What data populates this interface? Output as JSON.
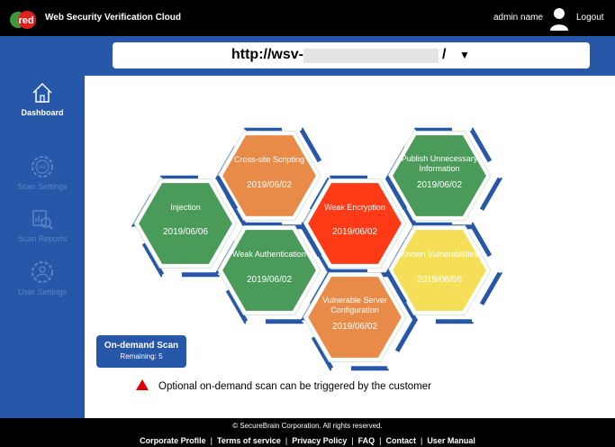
{
  "header": {
    "logo_text": "red",
    "app_title": "Web Security Verification Cloud",
    "admin_name": "admin name",
    "logout_label": "Logout"
  },
  "url_bar": {
    "url_prefix": "http://wsv-",
    "url_suffix": "/",
    "dropdown_glyph": "▼"
  },
  "sidebar": {
    "items": [
      {
        "label": "Dashboard",
        "icon": "home-icon"
      },
      {
        "label": "Scan Settings",
        "icon": "url-settings-icon"
      },
      {
        "label": "Scan Reports",
        "icon": "report-search-icon"
      },
      {
        "label": "User Settings",
        "icon": "user-gear-icon"
      }
    ]
  },
  "hexagons": [
    {
      "label": "Cross-site Scripting",
      "date": "2019/06/02",
      "status": "orange"
    },
    {
      "label": "Publish Unnecessary Information",
      "date": "2019/06/02",
      "status": "green"
    },
    {
      "label": "Injection",
      "date": "2019/06/06",
      "status": "green"
    },
    {
      "label": "Weak Encryption",
      "date": "2019/06/02",
      "status": "red"
    },
    {
      "label": "Weak Authentication",
      "date": "2019/06/02",
      "status": "green"
    },
    {
      "label": "Known Vulnerabilities",
      "date": "2019/06/06",
      "status": "yellow"
    },
    {
      "label": "Vulnerable Server Configuration",
      "date": "2019/06/02",
      "status": "orange"
    }
  ],
  "ondemand": {
    "title": "On-demand Scan",
    "remaining": "Remaining: 5"
  },
  "note": {
    "text": "Optional on-demand scan can be triggered by the customer"
  },
  "footer": {
    "copyright": "© SecureBrain Corporation. All rights reserved.",
    "links": [
      "Corporate Profile",
      "Terms of service",
      "Privacy Policy",
      "FAQ",
      "Contact",
      "User Manual"
    ]
  },
  "colors": {
    "brand_blue": "#2657a8",
    "green": "#4a9a5a",
    "orange": "#e98b48",
    "red": "#ff3b17",
    "yellow": "#f6df58",
    "note_marker": "#e00000"
  }
}
